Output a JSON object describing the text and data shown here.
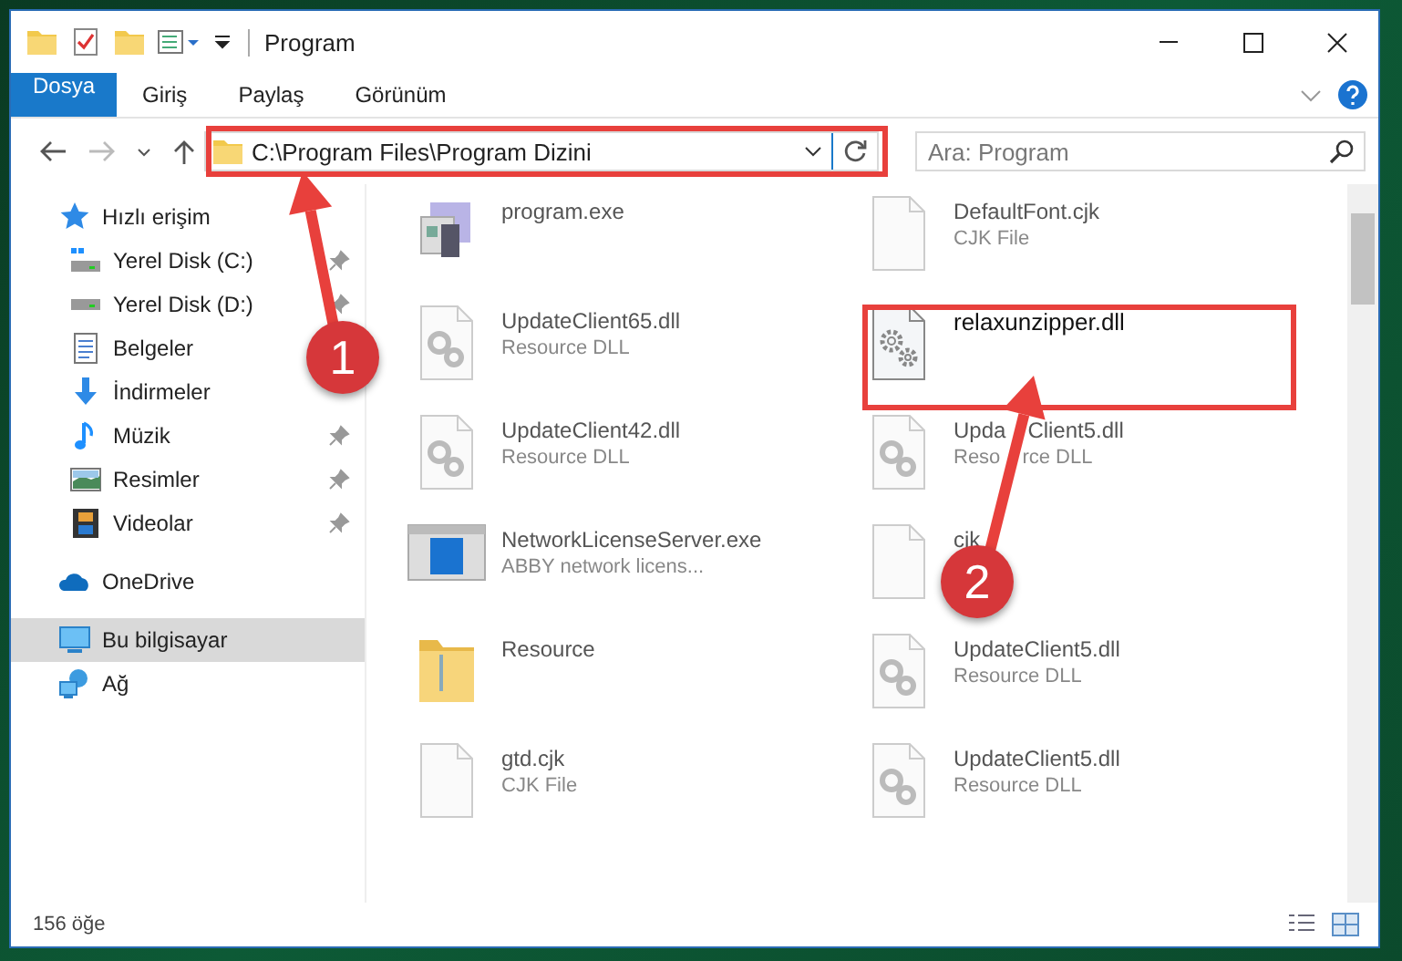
{
  "window": {
    "title": "Program"
  },
  "ribbon": {
    "tabs": [
      {
        "label": "Dosya",
        "kind": "file"
      },
      {
        "label": "Giriş",
        "kind": "tab"
      },
      {
        "label": "Paylaş",
        "kind": "tab"
      },
      {
        "label": "Görünüm",
        "kind": "tab"
      }
    ]
  },
  "address_bar": {
    "path": "C:\\Program Files\\Program Dizini"
  },
  "search": {
    "placeholder": "Ara: Program"
  },
  "sidebar": {
    "items": [
      {
        "label": "Hızlı erişim",
        "kind": "star",
        "selected": false,
        "children": [
          {
            "label": "Yerel Disk (C:)",
            "kind": "windrive",
            "pinned": true,
            "selected": false
          },
          {
            "label": "Yerel Disk (D:)",
            "kind": "drive",
            "pinned": true,
            "selected": false
          },
          {
            "label": "Belgeler",
            "kind": "documents",
            "pinned": false,
            "selected": false
          },
          {
            "label": "İndirmeler",
            "kind": "downloads",
            "pinned": false,
            "selected": false
          },
          {
            "label": "Müzik",
            "kind": "music",
            "pinned": true,
            "selected": false
          },
          {
            "label": "Resimler",
            "kind": "pictures",
            "pinned": true,
            "selected": false
          },
          {
            "label": "Videolar",
            "kind": "videos",
            "pinned": true,
            "selected": false
          }
        ]
      },
      {
        "label": "OneDrive",
        "kind": "cloud",
        "selected": false
      },
      {
        "label": "Bu bilgisayar",
        "kind": "computer",
        "selected": true
      },
      {
        "label": "Ağ",
        "kind": "network",
        "selected": false
      }
    ]
  },
  "files": [
    {
      "name": "program.exe",
      "kind": "exe"
    },
    {
      "name": "DefaultFont.cjk",
      "type": "CJK File",
      "kind": "blank"
    },
    {
      "name": "UpdateClient65.dll",
      "type": "Resource DLL",
      "kind": "dll"
    },
    {
      "name": "relaxunzipper.dll",
      "kind": "gears"
    },
    {
      "name": "UpdateClient42.dll",
      "type": "Resource DLL",
      "kind": "dll"
    },
    {
      "name_parts": [
        "Upda",
        "Client5.dll"
      ],
      "type_parts": [
        "Reso",
        "rce DLL"
      ],
      "kind": "dll"
    },
    {
      "name": "NetworkLicenseServer.exe",
      "type": "ABBY network licens...",
      "kind": "app"
    },
    {
      "name": "cjk",
      "kind": "blank"
    },
    {
      "name": "Resource",
      "kind": "folder"
    },
    {
      "name": "UpdateClient5.dll",
      "type": "Resource DLL",
      "kind": "dll"
    },
    {
      "name": "gtd.cjk",
      "type": "CJK File",
      "kind": "blank"
    },
    {
      "name": "UpdateClient5.dll",
      "type": "Resource DLL",
      "kind": "dll"
    }
  ],
  "status_bar": {
    "count": "156 öğe"
  },
  "annotations": [
    {
      "label": "1"
    },
    {
      "label": "2"
    }
  ]
}
